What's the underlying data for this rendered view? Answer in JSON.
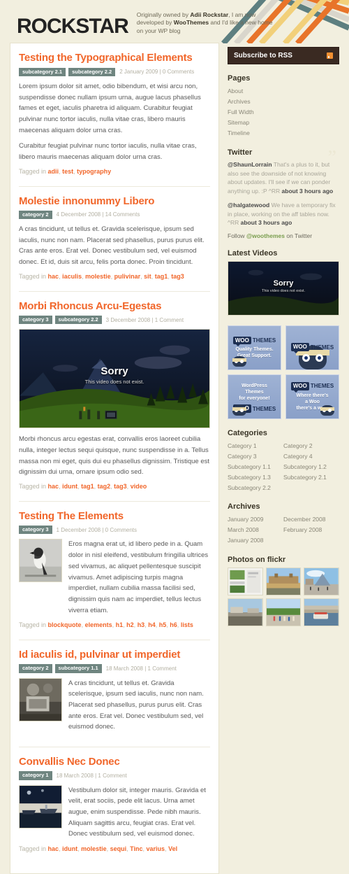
{
  "header": {
    "site_title": "ROCKSTAR",
    "tagline_parts": [
      "Originally owned by ",
      "Adii Rockstar",
      ", I am now developed by ",
      "WooThemes",
      " and I'd like a new home on your WP blog"
    ]
  },
  "posts": [
    {
      "title": "Testing the Typographical Elements",
      "categories": [
        "subcategory 2.1",
        "subcategory 2.2"
      ],
      "date": "2 January 2009 | 0 Comments",
      "paragraphs": [
        "Lorem ipsum dolor sit amet, odio bibendum, et wisi arcu non, suspendisse donec nullam ipsum urna, augue lacus phasellus fames et eget, iaculis pharetra id aliquam. Curabitur feugiat pulvinar nunc tortor iaculis, nulla vitae cras, libero mauris maecenas aliquam dolor urna cras.",
        "Curabitur feugiat pulvinar nunc tortor iaculis, nulla vitae cras, libero mauris maecenas aliquam dolor urna cras."
      ],
      "tagged_label": "Tagged in ",
      "tags": [
        "adii",
        "test",
        "typography"
      ],
      "media": "none"
    },
    {
      "title": "Molestie innonummy Libero",
      "categories": [
        "category 2"
      ],
      "date": "4 December 2008 | 14 Comments",
      "paragraphs": [
        "A cras tincidunt, ut tellus et. Gravida scelerisque, ipsum sed iaculis, nunc non nam. Placerat sed phasellus, purus purus elit. Cras ante eros. Erat vel. Donec vestibulum sed, vel euismod donec. Et id, duis sit arcu, felis porta donec. Proin tincidunt."
      ],
      "tagged_label": "Tagged in ",
      "tags": [
        "hac",
        "iaculis",
        "molestie",
        "pulivinar",
        "sit",
        "tag1",
        "tag3"
      ],
      "media": "none"
    },
    {
      "title": "Morbi Rhoncus Arcu-Egestas",
      "categories": [
        "category 3",
        "subcategory 2.2"
      ],
      "date": "3 December 2008 | 1 Comment",
      "paragraphs": [
        "Morbi rhoncus arcu egestas erat, convallis eros laoreet cubilia nulla, integer lectus sequi quisque, nunc suspendisse in a. Tellus massa non mi eget, quis dui eu phasellus dignissim. Tristique est dignissim dui urna, ornare ipsum odio sed."
      ],
      "tagged_label": "Tagged in ",
      "tags": [
        "hac",
        "idunt",
        "tag1",
        "tag2",
        "tag3",
        "video"
      ],
      "media": "video",
      "video": {
        "title": "Sorry",
        "subtitle": "This video does not exist."
      }
    },
    {
      "title": "Testing The Elements",
      "categories": [
        "category 3"
      ],
      "date": "1 December 2008 | 0 Comments",
      "paragraphs": [
        "Eros magna erat ut, id libero pede in a. Quam dolor in nisl eleifend, vestibulum fringilla ultrices sed vivamus, ac aliquet pellentesque suscipit vivamus. Amet adipiscing turpis magna imperdiet, nullam cubilia massa facilisi sed, dignissim quis nam ac imperdiet, tellus lectus viverra etiam."
      ],
      "tagged_label": "Tagged in ",
      "tags": [
        "blockquote",
        "elements",
        "h1",
        "h2",
        "h3",
        "h4",
        "h5",
        "h6",
        "lists"
      ],
      "media": "thumb",
      "thumb_kind": "bird"
    },
    {
      "title": "Id iaculis id, pulvinar ut imperdiet",
      "categories": [
        "category 2",
        "subcategory 1.1"
      ],
      "date": "18 March 2008 | 1 Comment",
      "paragraphs": [
        "A cras tincidunt, ut tellus et. Gravida scelerisque, ipsum sed iaculis, nunc non nam. Placerat sed phasellus, purus purus elit. Cras ante eros. Erat vel. Donec vestibulum sed, vel euismod donec."
      ],
      "tagged_label": "",
      "tags": [],
      "media": "thumb",
      "thumb_kind": "machine"
    },
    {
      "title": "Convallis Nec Donec",
      "categories": [
        "category 1"
      ],
      "date": "18 March 2008 | 1 Comment",
      "paragraphs": [
        "Vestibulum dolor sit, integer mauris. Gravida et velit, erat sociis, pede elit lacus. Urna amet augue, enim suspendisse. Pede nibh mauris. Aliquam sagittis arcu, feugiat cras. Erat vel. Donec vestibulum sed, vel euismod donec."
      ],
      "tagged_label": "Tagged in ",
      "tags": [
        "hac",
        "idunt",
        "molestie",
        "sequi",
        "Tinc",
        "varius",
        "Vel"
      ],
      "media": "thumb",
      "thumb_kind": "boat"
    }
  ],
  "sidebar": {
    "rss_label": "Subscribe to RSS",
    "pages": {
      "heading": "Pages",
      "items": [
        "About",
        "Archives",
        "Full Width",
        "Sitemap",
        "Timeline"
      ]
    },
    "twitter": {
      "heading": "Twitter",
      "tweets": [
        {
          "handle": "@ShaunLorrain",
          "text": " That's a plus to it, but also see the downside of not knowing about updates. I'll see if we can ponder anything up. :P ^RR ",
          "ago": "about 3 hours ago"
        },
        {
          "handle": "@halgatewood",
          "text": " We have a temporary fix in place, working on the aff tables now. ^RR ",
          "ago": "about 3 hours ago"
        }
      ],
      "follow_pre": "Follow ",
      "follow_handle": "@woothemes",
      "follow_post": " on Twitter"
    },
    "videos": {
      "heading": "Latest Videos",
      "title": "Sorry",
      "subtitle": "This video does not exist."
    },
    "ads": [
      {
        "logo_badge": "WOO",
        "logo_word": "THEMES",
        "tagline": "Quality Themes.\nGreat Support.",
        "art": "small-ninja"
      },
      {
        "logo_badge": "WOO",
        "logo_word": "THEMES",
        "tagline": "",
        "art": "big-ninja"
      },
      {
        "logo_badge": "WOO",
        "logo_word": "THEMES",
        "tagline": "WordPress\nThemes\nfor everyone!",
        "art": "small-ninja"
      },
      {
        "logo_badge": "WOO",
        "logo_word": "THEMES",
        "tagline": "Where there's\na Woo\nthere's a way!",
        "art": "small-ninja"
      }
    ],
    "categories": {
      "heading": "Categories",
      "col1": [
        "Category 1",
        "Category 3",
        "Subcategory 1.1",
        "Subcategory 1.3",
        "Subcategory 2.2"
      ],
      "col2": [
        "Category 2",
        "Category 4",
        "Subcategory 1.2",
        "Subcategory 2.1"
      ]
    },
    "archives": {
      "heading": "Archives",
      "col1": [
        "January 2009",
        "March 2008",
        "January 2008"
      ],
      "col2": [
        "December 2008",
        "February 2008"
      ]
    },
    "flickr": {
      "heading": "Photos on flickr",
      "count": 6
    }
  },
  "colors": {
    "accent": "#f1662a",
    "badge": "#6f8580",
    "page_bg": "#f2efdf",
    "rss_bg": "#3a2a22",
    "ribbon": [
      "#5d7f80",
      "#d9d6cc",
      "#e8742a",
      "#f2d07a"
    ]
  }
}
